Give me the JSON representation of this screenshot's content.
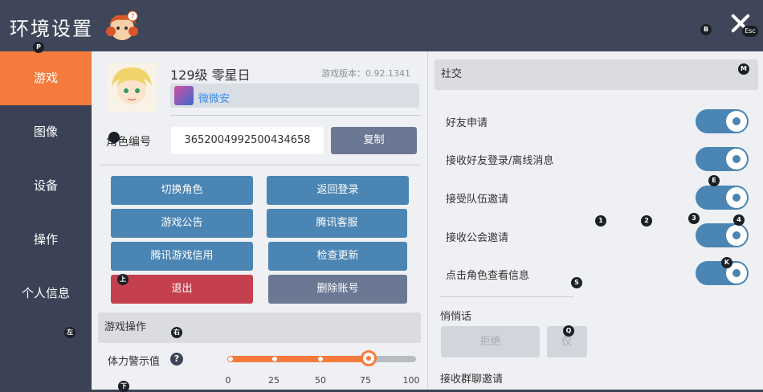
{
  "header": {
    "title": "环境设置",
    "close_hotkey": "Esc"
  },
  "hotkeys": {
    "p": "P",
    "b": "B",
    "m": "M",
    "e": "E",
    "k": "K",
    "s": "S",
    "q": "Q",
    "n1": "1",
    "n2": "2",
    "n3": "3",
    "n4": "4",
    "up": "上",
    "left": "左",
    "right": "右",
    "down": "下"
  },
  "sidebar": {
    "items": [
      {
        "label": "游戏",
        "active": true
      },
      {
        "label": "图像"
      },
      {
        "label": "设备"
      },
      {
        "label": "操作"
      },
      {
        "label": "个人信息"
      }
    ]
  },
  "profile": {
    "level_name": "129级 零星日",
    "version": "游戏版本：0.92.1341",
    "guild": "微微安",
    "role_label": "角色编号",
    "role_id": "3652004992500434658",
    "copy_button": "复制"
  },
  "actions": {
    "switch_role": "切换角色",
    "back_login": "返回登录",
    "notice": "游戏公告",
    "service": "腾讯客服",
    "credit": "腾讯游戏信用",
    "update": "检查更新",
    "exit": "退出",
    "delete": "删除账号"
  },
  "game_ops": {
    "title": "游戏操作",
    "stamina_label": "体力警示值",
    "help": "?",
    "ticks": [
      "0",
      "25",
      "50",
      "75",
      "100"
    ],
    "value": 75
  },
  "social": {
    "title": "社交",
    "items": [
      {
        "label": "好友申请",
        "on": true
      },
      {
        "label": "接收好友登录/离线消息",
        "on": true
      },
      {
        "label": "接受队伍邀请",
        "on": true
      },
      {
        "label": "接收公会邀请",
        "on": true
      },
      {
        "label": "点击角色查看信息",
        "on": true
      }
    ],
    "whisper_title": "悄悄话",
    "reject": "拒绝",
    "allow": "仅",
    "group_chat": "接收群聊邀请"
  },
  "colors": {
    "accent": "#f47b3b",
    "toggle": "#4a85b4",
    "sidebar": "#3b4256",
    "danger": "#c5404f"
  }
}
